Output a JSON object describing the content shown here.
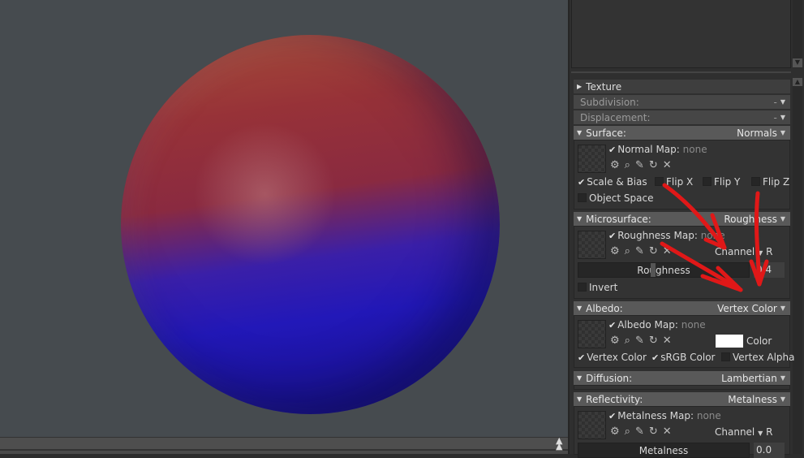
{
  "panel": {
    "texture": {
      "label": "Texture"
    },
    "subdivision": {
      "label": "Subdivision:",
      "value": "-"
    },
    "displacement": {
      "label": "Displacement:",
      "value": "-"
    },
    "surface": {
      "label": "Surface:",
      "value": "Normals",
      "map_label": "Normal Map:",
      "map_value": "none",
      "options": {
        "scale_bias": "Scale & Bias",
        "flip_x": "Flip X",
        "flip_y": "Flip Y",
        "flip_z": "Flip Z",
        "object_space": "Object Space"
      },
      "checked": {
        "scale_bias": true,
        "flip_x": false,
        "flip_y": false,
        "flip_z": false,
        "object_space": false
      }
    },
    "microsurface": {
      "label": "Microsurface:",
      "value": "Roughness",
      "map_label": "Roughness Map:",
      "map_value": "none",
      "channel_label": "Channel",
      "channel_value": "R",
      "slider_label": "Roughness",
      "slider_value": "0.4",
      "invert": "Invert"
    },
    "albedo": {
      "label": "Albedo:",
      "value": "Vertex Color",
      "map_label": "Albedo Map:",
      "map_value": "none",
      "color_label": "Color",
      "color": "#ffffff",
      "options": {
        "vertex_color": "Vertex Color",
        "srgb": "sRGB Color",
        "vertex_alpha": "Vertex Alpha"
      }
    },
    "diffusion": {
      "label": "Diffusion:",
      "value": "Lambertian"
    },
    "reflectivity": {
      "label": "Reflectivity:",
      "value": "Metalness",
      "map_label": "Metalness Map:",
      "map_value": "none",
      "channel_label": "Channel",
      "channel_value": "R",
      "slider_label": "Metalness",
      "slider_value": "0.0"
    }
  },
  "icons": {
    "gear": "⚙",
    "search": "🔍",
    "edit": "✎",
    "reload": "↻",
    "close": "✕"
  },
  "colors": {
    "viewport_bg": "#464b4f",
    "annotation": "#e01818"
  }
}
